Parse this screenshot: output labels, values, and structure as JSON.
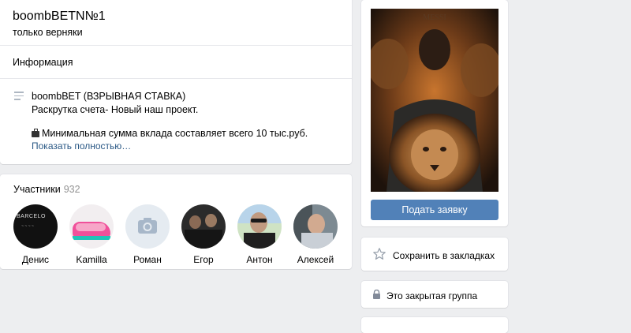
{
  "group": {
    "title": "boombBETN№1",
    "status": "только верняки"
  },
  "info": {
    "heading": "Информация",
    "lines": [
      "boombBET (ВЗРЫВНАЯ СТАВКА)",
      "Раскрутка счета- Новый наш проект.",
      "Минимальная сумма вклада составляет всего 10 тыс.руб."
    ],
    "show_more": "Показать полностью…"
  },
  "members": {
    "heading": "Участники",
    "count": "932",
    "list": [
      {
        "name": "Денис",
        "avatar_text": "BARCELO"
      },
      {
        "name": "Kamilla"
      },
      {
        "name": "Роман"
      },
      {
        "name": "Егор"
      },
      {
        "name": "Антон"
      },
      {
        "name": "Алексей"
      }
    ]
  },
  "sidebar": {
    "apply_button": "Подать заявку",
    "bookmark": "Сохранить в закладках",
    "private_group": "Это закрытая группа"
  },
  "colors": {
    "accent": "#5181b8",
    "link": "#2a5885",
    "page_bg": "#edeef0"
  }
}
